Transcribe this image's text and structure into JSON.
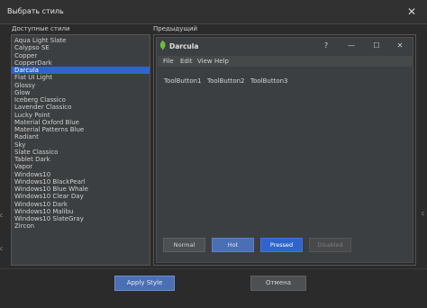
{
  "window": {
    "title": "Выбрать стиль",
    "close_glyph": "✕"
  },
  "labels": {
    "available_styles": "Доступные стили",
    "preview": "Предыдущий"
  },
  "styles": [
    "Aqua Light Slate",
    "Calypso SE",
    "Copper",
    "CopperDark",
    "Darcula",
    "Flat UI Light",
    "Glossy",
    "Glow",
    "Iceberg Classico",
    "Lavender Classico",
    "Lucky Point",
    "Material Oxford Blue",
    "Material Patterns Blue",
    "Radiant",
    "Sky",
    "Slate Classico",
    "Tablet Dark",
    "Vapor",
    "Windows10",
    "Windows10 BlackPearl",
    "Windows10 Blue Whale",
    "Windows10 Clear Day",
    "Windows10 Dark",
    "Windows10 Malibu",
    "Windows10 SlateGray",
    "Zircon"
  ],
  "selected_style": "Darcula",
  "preview": {
    "title": "Darcula",
    "controls": {
      "help": "?",
      "minimize": "—",
      "maximize": "☐",
      "close": "✕"
    },
    "menu": [
      "File",
      "Edit",
      "View",
      "Help"
    ],
    "tool_buttons": [
      "ToolButton1",
      "ToolButton2",
      "ToolButton3"
    ],
    "buttons": {
      "normal": "Normal",
      "hot": "Hot",
      "pressed": "Pressed",
      "disabled": "Disabled"
    },
    "logo_color": "#6abf3a"
  },
  "footer": {
    "apply": "Apply Style",
    "cancel": "Отмена"
  },
  "colors": {
    "accent": "#2f65ca",
    "background": "#2b2b2b",
    "panel": "#3c3f41"
  },
  "edge": {
    "left": [
      "с",
      "с"
    ],
    "right": [
      "с"
    ]
  }
}
